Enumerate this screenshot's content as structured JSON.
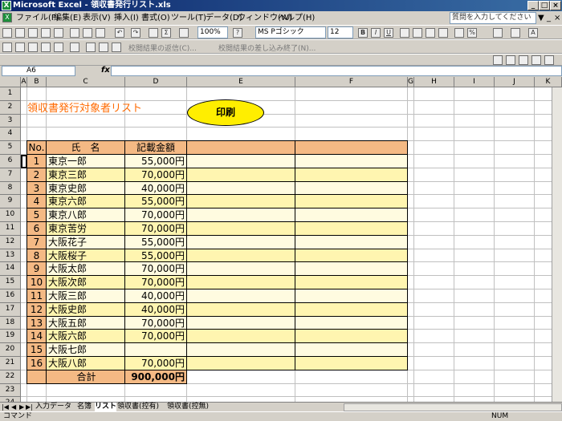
{
  "window": {
    "title": "Microsoft Excel - 領収書発行リスト.xls",
    "app_icon": "excel-icon"
  },
  "menu": {
    "items": [
      "ファイル(F)",
      "編集(E)",
      "表示(V)",
      "挿入(I)",
      "書式(O)",
      "ツール(T)",
      "データ(D)",
      "ウィンドウ(W)",
      "ヘルプ(H)"
    ],
    "help_placeholder": "質問を入力してください"
  },
  "toolbar": {
    "zoom": "100%",
    "font_name": "MS Pゴシック",
    "font_size": "12",
    "review_reply": "校閲結果の返信(C)...",
    "review_end": "校閲結果の差し込み終了(N)..."
  },
  "formula_bar": {
    "name_box": "A6",
    "fx_label": "fx",
    "content": ""
  },
  "columns": [
    "A",
    "B",
    "C",
    "D",
    "E",
    "F",
    "G",
    "H",
    "I",
    "J",
    "K"
  ],
  "rows": [
    "1",
    "2",
    "3",
    "4",
    "5",
    "6",
    "7",
    "8",
    "9",
    "10",
    "11",
    "12",
    "13",
    "14",
    "15",
    "16",
    "17",
    "18",
    "19",
    "20",
    "21",
    "22",
    "23",
    "24"
  ],
  "sheet": {
    "title": "領収書発行対象者リスト",
    "print_button": "印刷",
    "headers": {
      "no": "No.",
      "name": "氏　名",
      "amount": "記載金額"
    },
    "records": [
      {
        "no": "1",
        "name": "東京一郎",
        "amount": "55,000円"
      },
      {
        "no": "2",
        "name": "東京三郎",
        "amount": "70,000円"
      },
      {
        "no": "3",
        "name": "東京史郎",
        "amount": "40,000円"
      },
      {
        "no": "4",
        "name": "東京六郎",
        "amount": "55,000円"
      },
      {
        "no": "5",
        "name": "東京八郎",
        "amount": "70,000円"
      },
      {
        "no": "6",
        "name": "東京苦労",
        "amount": "70,000円"
      },
      {
        "no": "7",
        "name": "大阪花子",
        "amount": "55,000円"
      },
      {
        "no": "8",
        "name": "大阪桜子",
        "amount": "55,000円"
      },
      {
        "no": "9",
        "name": "大阪太郎",
        "amount": "70,000円"
      },
      {
        "no": "10",
        "name": "大阪次郎",
        "amount": "70,000円"
      },
      {
        "no": "11",
        "name": "大阪三郎",
        "amount": "40,000円"
      },
      {
        "no": "12",
        "name": "大阪史郎",
        "amount": "40,000円"
      },
      {
        "no": "13",
        "name": "大阪五郎",
        "amount": "70,000円"
      },
      {
        "no": "14",
        "name": "大阪六郎",
        "amount": "70,000円"
      },
      {
        "no": "15",
        "name": "大阪七郎",
        "amount": ""
      },
      {
        "no": "16",
        "name": "大阪八郎",
        "amount": "70,000円"
      }
    ],
    "total_label": "合計",
    "total_amount": "900,000円"
  },
  "tabs": [
    "入力データ",
    "名簿",
    "リスト",
    "領収書(控有)",
    "領収書(控無)"
  ],
  "active_tab": "リスト",
  "status": {
    "left": "コマンド",
    "right": "NUM"
  },
  "colors": {
    "header_fill": "#f4b984",
    "row_fill_light": "#fffbe0",
    "row_fill_dark": "#fff5b0",
    "title_color": "#ff6a00",
    "button_fill": "#ffee00"
  }
}
